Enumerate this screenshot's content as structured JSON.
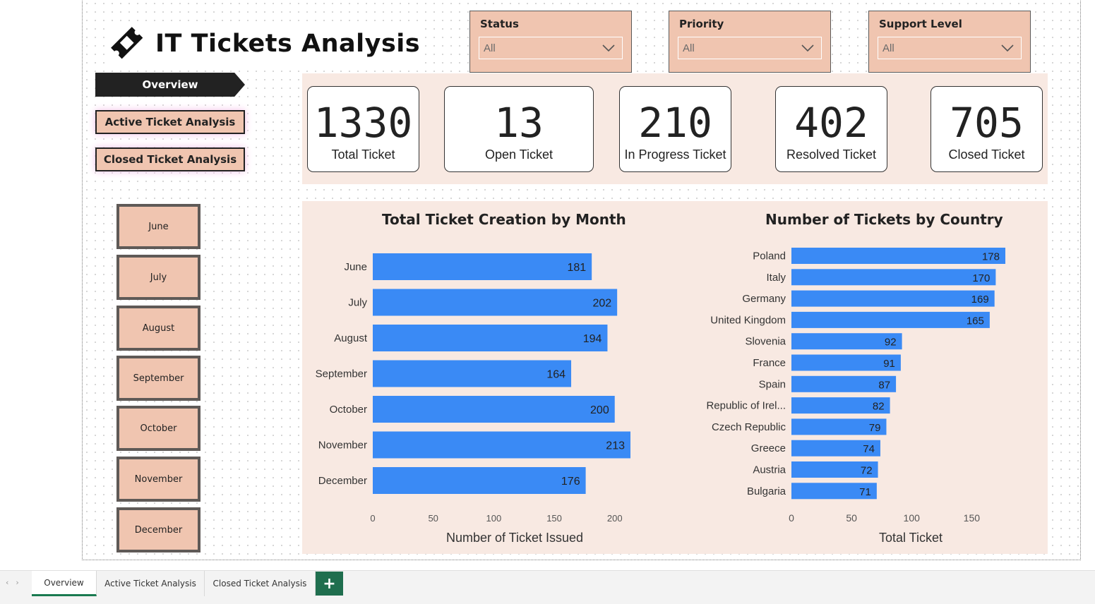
{
  "app": {
    "title": "IT Tickets Analysis"
  },
  "filters": [
    {
      "label": "Status",
      "value": "All"
    },
    {
      "label": "Priority",
      "value": "All"
    },
    {
      "label": "Support Level",
      "value": "All"
    }
  ],
  "nav": {
    "overview": "Overview",
    "active": "Active Ticket Analysis",
    "closed": "Closed Ticket Analysis"
  },
  "kpis": [
    {
      "value": "1330",
      "label": "Total Ticket"
    },
    {
      "value": "13",
      "label": "Open Ticket"
    },
    {
      "value": "210",
      "label": "In Progress Ticket"
    },
    {
      "value": "402",
      "label": "Resolved Ticket"
    },
    {
      "value": "705",
      "label": "Closed Ticket"
    }
  ],
  "months": [
    "June",
    "July",
    "August",
    "September",
    "October",
    "November",
    "December"
  ],
  "colors": {
    "bar": "#3a8af5",
    "accent": "#f0c5b0",
    "panel": "#f8e9e2",
    "tab_green": "#1f6e4e"
  },
  "chart_data": [
    {
      "type": "bar",
      "orientation": "horizontal",
      "title": "Total Ticket Creation by Month",
      "xlabel": "Number of Ticket Issued",
      "ylabel": "",
      "categories": [
        "June",
        "July",
        "August",
        "September",
        "October",
        "November",
        "December"
      ],
      "values": [
        181,
        202,
        194,
        164,
        200,
        213,
        176
      ],
      "xticks": [
        0,
        50,
        100,
        150,
        200
      ],
      "xlim": [
        0,
        213
      ],
      "grid": false
    },
    {
      "type": "bar",
      "orientation": "horizontal",
      "title": "Number of Tickets by Country",
      "xlabel": "Total Ticket",
      "ylabel": "",
      "categories": [
        "Poland",
        "Italy",
        "Germany",
        "United Kingdom",
        "Slovenia",
        "France",
        "Spain",
        "Republic of Irel...",
        "Czech Republic",
        "Greece",
        "Austria",
        "Bulgaria"
      ],
      "values": [
        178,
        170,
        169,
        165,
        92,
        91,
        87,
        82,
        79,
        74,
        72,
        71
      ],
      "xticks": [
        0,
        50,
        100,
        150
      ],
      "xlim": [
        0,
        178
      ],
      "grid": false
    }
  ],
  "tabs": [
    "Overview",
    "Active Ticket Analysis",
    "Closed Ticket Analysis"
  ],
  "add_tab": "+"
}
